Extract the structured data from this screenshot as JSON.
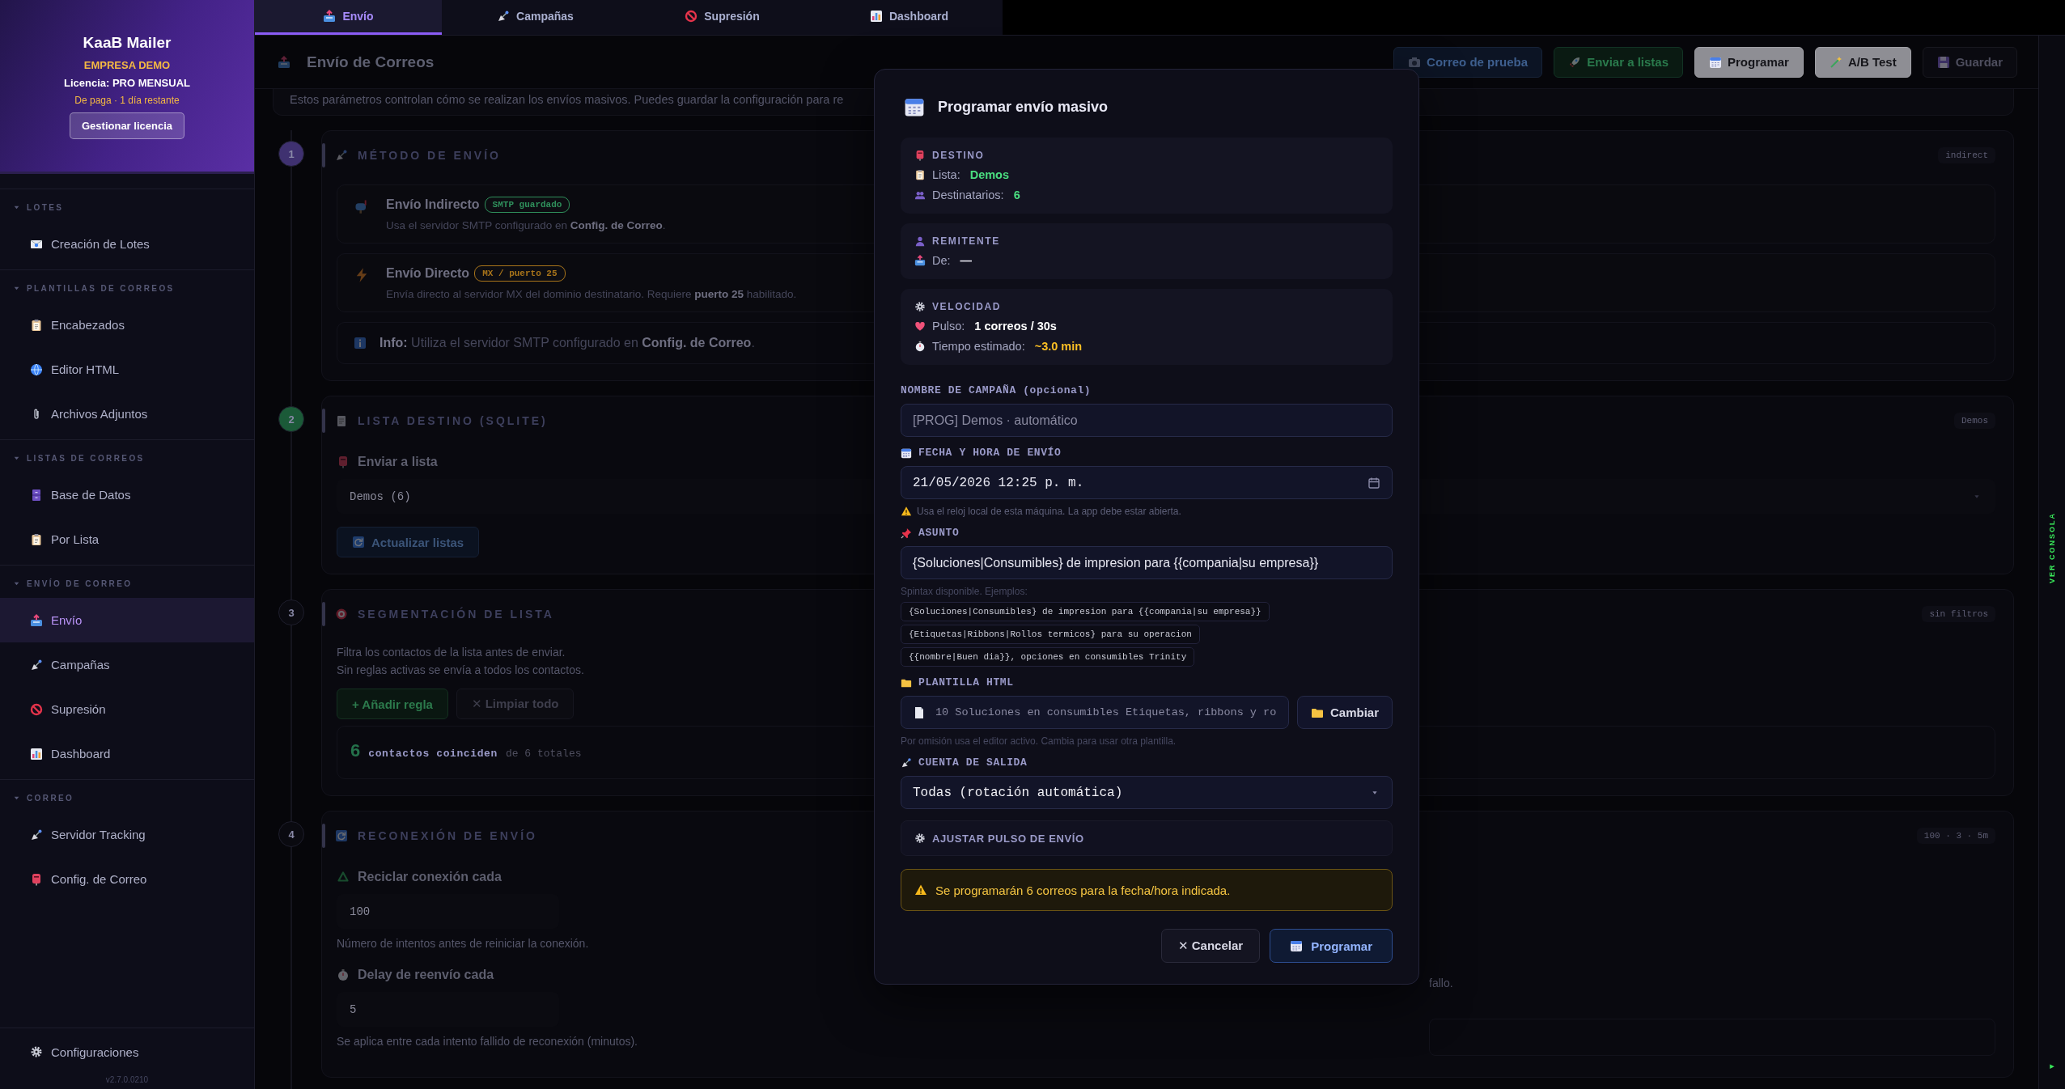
{
  "sidebar": {
    "brand": "KaaB Mailer",
    "company": "EMPRESA DEMO",
    "license": "Licencia: PRO MENSUAL",
    "license_status": "De paga · 1 día restante",
    "license_button": "Gestionar licencia",
    "groups": [
      {
        "title": "LOTES",
        "expanded": true,
        "items": [
          {
            "label": "Creación de Lotes",
            "selected": false
          }
        ]
      },
      {
        "title": "PLANTILLAS DE CORREOS",
        "expanded": true,
        "items": [
          {
            "label": "Encabezados",
            "selected": false
          },
          {
            "label": "Editor HTML",
            "selected": false
          },
          {
            "label": "Archivos Adjuntos",
            "selected": false
          }
        ]
      },
      {
        "title": "LISTAS DE CORREOS",
        "expanded": true,
        "items": [
          {
            "label": "Base de Datos",
            "selected": false
          },
          {
            "label": "Por Lista",
            "selected": false
          }
        ]
      },
      {
        "title": "ENVÍO DE CORREO",
        "expanded": true,
        "items": [
          {
            "label": "Envío",
            "selected": true
          },
          {
            "label": "Campañas",
            "selected": false
          },
          {
            "label": "Supresión",
            "selected": false
          },
          {
            "label": "Dashboard",
            "selected": false
          }
        ]
      },
      {
        "title": "CORREO",
        "expanded": true,
        "items": [
          {
            "label": "Servidor Tracking",
            "selected": false
          },
          {
            "label": "Config. de Correo",
            "selected": false
          }
        ]
      }
    ],
    "footer_item": "Configuraciones",
    "version": "v2.7.0.0210"
  },
  "tabs": [
    {
      "label": "Envío",
      "selected": true
    },
    {
      "label": "Campañas",
      "selected": false
    },
    {
      "label": "Supresión",
      "selected": false
    },
    {
      "label": "Dashboard",
      "selected": false
    }
  ],
  "header": {
    "title": "Envío de Correos",
    "actions": [
      {
        "label": "Correo de prueba",
        "kind": "info"
      },
      {
        "label": "Enviar a listas",
        "kind": "success"
      },
      {
        "label": "Programar",
        "kind": "highlight"
      },
      {
        "label": "A/B Test",
        "kind": "highlight"
      },
      {
        "label": "Guardar",
        "kind": "neutral"
      }
    ]
  },
  "intro": "Estos parámetros controlan cómo se realizan los envíos masivos. Puedes guardar la configuración para re",
  "steps": [
    {
      "kind": "method",
      "number": "1",
      "color": "#3f3170",
      "title": "MÉTODO DE ENVÍO",
      "tag": "indirect",
      "options": [
        {
          "title": "Envío Indirecto",
          "tag": "SMTP guardado",
          "color": "#2f8f5b",
          "description": "Usa el servidor SMTP configurado en **Config. de Correo**."
        },
        {
          "title": "Envío Directo",
          "tag": "MX / puerto 25",
          "color": "#a8741a",
          "description": "Envía directo al servidor MX del dominio destinatario. Requiere **puerto 25** habilitado."
        }
      ],
      "info": "**Info:** Utiliza el servidor SMTP configurado en **Config. de Correo**."
    },
    {
      "kind": "list",
      "number": "2",
      "color": "#1b5a38",
      "title": "LISTA DESTINO (SQLITE)",
      "tag": "Demos",
      "field_label": "Enviar a lista",
      "value": "Demos (6)",
      "button": "Actualizar listas"
    },
    {
      "kind": "segment",
      "number": "3",
      "color": "#0a0a10",
      "title": "SEGMENTACIÓN DE LISTA",
      "tag": "sin filtros",
      "lines": [
        "Filtra los contactos de la lista antes de enviar.",
        "Sin reglas activas se envía a todos los contactos."
      ],
      "add_button": "+ Añadir regla",
      "clear_button": "✕ Limpiar todo",
      "match_count": "6",
      "match_label": "contactos coinciden",
      "match_total": "de 6 totales"
    },
    {
      "kind": "reconnect",
      "number": "4",
      "color": "#0a0a10",
      "title": "RECONEXIÓN DE ENVÍO",
      "tag": "100 · 3 · 5m",
      "fields": [
        {
          "label": "Reciclar conexión cada",
          "value": "100",
          "help": "Número de intentos antes de reiniciar la conexión."
        },
        {
          "label": "Delay de reenvío cada",
          "value": "5",
          "help": "Se aplica entre cada intento fallido de reconexión (minutos)."
        }
      ],
      "side_help": "fallo."
    }
  ],
  "modal": {
    "title": "Programar envío masivo",
    "summary": [
      {
        "title": "DESTINO",
        "rows": [
          {
            "label": "Lista:",
            "value": "Demos",
            "color": "#4ade80"
          },
          {
            "label": "Destinatarios:",
            "value": "6",
            "color": "#4ade80"
          }
        ]
      },
      {
        "title": "REMITENTE",
        "rows": [
          {
            "label": "De:",
            "value": "—",
            "color": "#e6e6f0"
          }
        ]
      },
      {
        "title": "VELOCIDAD",
        "rows": [
          {
            "label": "Pulso:",
            "value": "1 correos / 30s",
            "color": "#ffffff"
          },
          {
            "label": "Tiempo estimado:",
            "value": "~3.0 min",
            "color": "#fbbf24"
          }
        ]
      }
    ],
    "campaign": {
      "label": "NOMBRE DE CAMPAÑA (opcional)",
      "placeholder": "[PROG] Demos · automático"
    },
    "schedule": {
      "label": "FECHA Y HORA DE ENVÍO",
      "value": "21/05/2026 12:25 p. m.",
      "hint": "Usa el reloj local de esta máquina. La app debe estar abierta."
    },
    "subject": {
      "label": "ASUNTO",
      "value": "{Soluciones|Consumibles} de impresion para {{compania|su empresa}}",
      "hint": "Spintax disponible. Ejemplos:",
      "examples": [
        "{Soluciones|Consumibles} de impresion para {{compania|su empresa}}",
        "{Etiquetas|Ribbons|Rollos termicos} para su operacion",
        "{{nombre|Buen dia}}, opciones en consumibles Trinity"
      ]
    },
    "template": {
      "label": "PLANTILLA HTML",
      "value": "10 Soluciones en consumibles Etiquetas, ribbons y ro",
      "button": "Cambiar",
      "hint": "Por omisión usa el editor activo. Cambia para usar otra plantilla."
    },
    "account": {
      "label": "CUENTA DE SALIDA",
      "value": "Todas (rotación automática)"
    },
    "pulse": {
      "label": "AJUSTAR PULSO DE ENVÍO"
    },
    "warning": "Se programarán 6 correos para la fecha/hora indicada.",
    "cancel": "✕ Cancelar",
    "confirm": "Programar"
  },
  "console": {
    "label": "VER CONSOLA",
    "toggle": "▸"
  }
}
